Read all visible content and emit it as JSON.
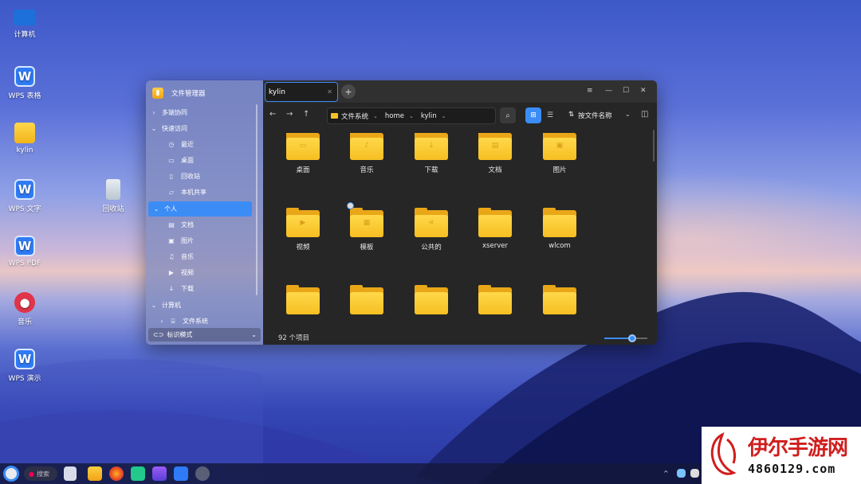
{
  "desktop": {
    "icons": [
      {
        "label": "计算机",
        "icon": "computer-icon"
      },
      {
        "label": "WPS 表格",
        "icon": "wps-sheet-icon"
      },
      {
        "label": "kylin",
        "icon": "folder-icon"
      },
      {
        "label": "WPS 文字",
        "icon": "wps-writer-icon"
      },
      {
        "label": "WPS PDF",
        "icon": "wps-pdf-icon"
      },
      {
        "label": "音乐",
        "icon": "music-icon"
      },
      {
        "label": "WPS 演示",
        "icon": "wps-presentation-icon"
      },
      {
        "label": "回收站",
        "icon": "trash-icon"
      }
    ]
  },
  "window": {
    "app_title": "文件管理器",
    "sidebar": {
      "groups": [
        {
          "label": "多端协同",
          "expanded": false
        },
        {
          "label": "快速访问",
          "expanded": true
        },
        {
          "label": "个人",
          "expanded": true,
          "selected": true
        },
        {
          "label": "计算机",
          "expanded": true
        }
      ],
      "quick_access": [
        {
          "label": "最近",
          "icon": "clock-icon"
        },
        {
          "label": "桌面",
          "icon": "monitor-icon"
        },
        {
          "label": "回收站",
          "icon": "trash-icon"
        },
        {
          "label": "本机共享",
          "icon": "folder-share-icon"
        }
      ],
      "personal": [
        {
          "label": "文档",
          "icon": "document-icon"
        },
        {
          "label": "图片",
          "icon": "image-icon"
        },
        {
          "label": "音乐",
          "icon": "music-note-icon"
        },
        {
          "label": "视频",
          "icon": "video-icon"
        },
        {
          "label": "下载",
          "icon": "download-icon"
        }
      ],
      "computer": [
        {
          "label": "文件系统",
          "icon": "drive-icon"
        }
      ],
      "bottom_mode": "标识模式"
    },
    "tabs": [
      {
        "label": "kylin",
        "active": true
      }
    ],
    "new_tab": "+",
    "toolbar": {
      "back": "←",
      "forward": "→",
      "up": "↑",
      "breadcrumbs": [
        "文件系统",
        "home",
        "kylin"
      ],
      "search_icon": "search-icon",
      "view_icon_mode": "grid-view-icon",
      "view_list_mode": "list-view-icon",
      "sort_label": "按文件名称",
      "pane_icon": "side-pane-icon"
    },
    "files": [
      {
        "name": "桌面",
        "emblem": "monitor"
      },
      {
        "name": "音乐",
        "emblem": "music"
      },
      {
        "name": "下载",
        "emblem": "download"
      },
      {
        "name": "文档",
        "emblem": "document"
      },
      {
        "name": "图片",
        "emblem": "image"
      },
      {
        "name": "视频",
        "emblem": "video"
      },
      {
        "name": "模板",
        "emblem": "template"
      },
      {
        "name": "公共的",
        "emblem": "share"
      },
      {
        "name": "xserver",
        "emblem": ""
      },
      {
        "name": "wlcom",
        "emblem": ""
      },
      {
        "name": "",
        "emblem": ""
      },
      {
        "name": "",
        "emblem": ""
      },
      {
        "name": "",
        "emblem": ""
      },
      {
        "name": "",
        "emblem": ""
      },
      {
        "name": "",
        "emblem": ""
      }
    ],
    "status": {
      "item_count": "92 个项目",
      "zoom_fraction": 0.65
    }
  },
  "taskbar": {
    "search_label": "搜索"
  },
  "watermark": {
    "title": "伊尔手游网",
    "subtitle": "4860129.com"
  },
  "colors": {
    "accent": "#3b8cf5",
    "folder": "#f6bf22",
    "watermark_red": "#d01d1d"
  }
}
